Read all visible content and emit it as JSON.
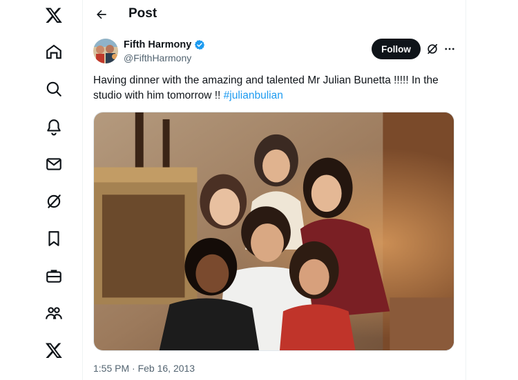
{
  "header": {
    "title": "Post",
    "back_icon": "arrow-left-icon"
  },
  "nav": {
    "items": [
      {
        "name": "x-logo-icon"
      },
      {
        "name": "home-icon"
      },
      {
        "name": "explore-icon"
      },
      {
        "name": "notifications-icon"
      },
      {
        "name": "messages-icon"
      },
      {
        "name": "grok-icon"
      },
      {
        "name": "bookmarks-icon"
      },
      {
        "name": "jobs-icon"
      },
      {
        "name": "communities-icon"
      },
      {
        "name": "premium-icon"
      }
    ]
  },
  "post": {
    "author_name": "Fifth Harmony",
    "author_handle": "@FifthHarmony",
    "verified": true,
    "follow_label": "Follow",
    "text_main": "Having dinner with the amazing and talented Mr Julian Bunetta !!!!! In the studio with him tomorrow !! ",
    "hashtag": "#julianbulian",
    "timestamp": "1:55 PM · Feb 16, 2013"
  },
  "colors": {
    "accent": "#1d9bf0",
    "text": "#0f1419",
    "secondary": "#536471",
    "button_bg": "#0f1419"
  }
}
